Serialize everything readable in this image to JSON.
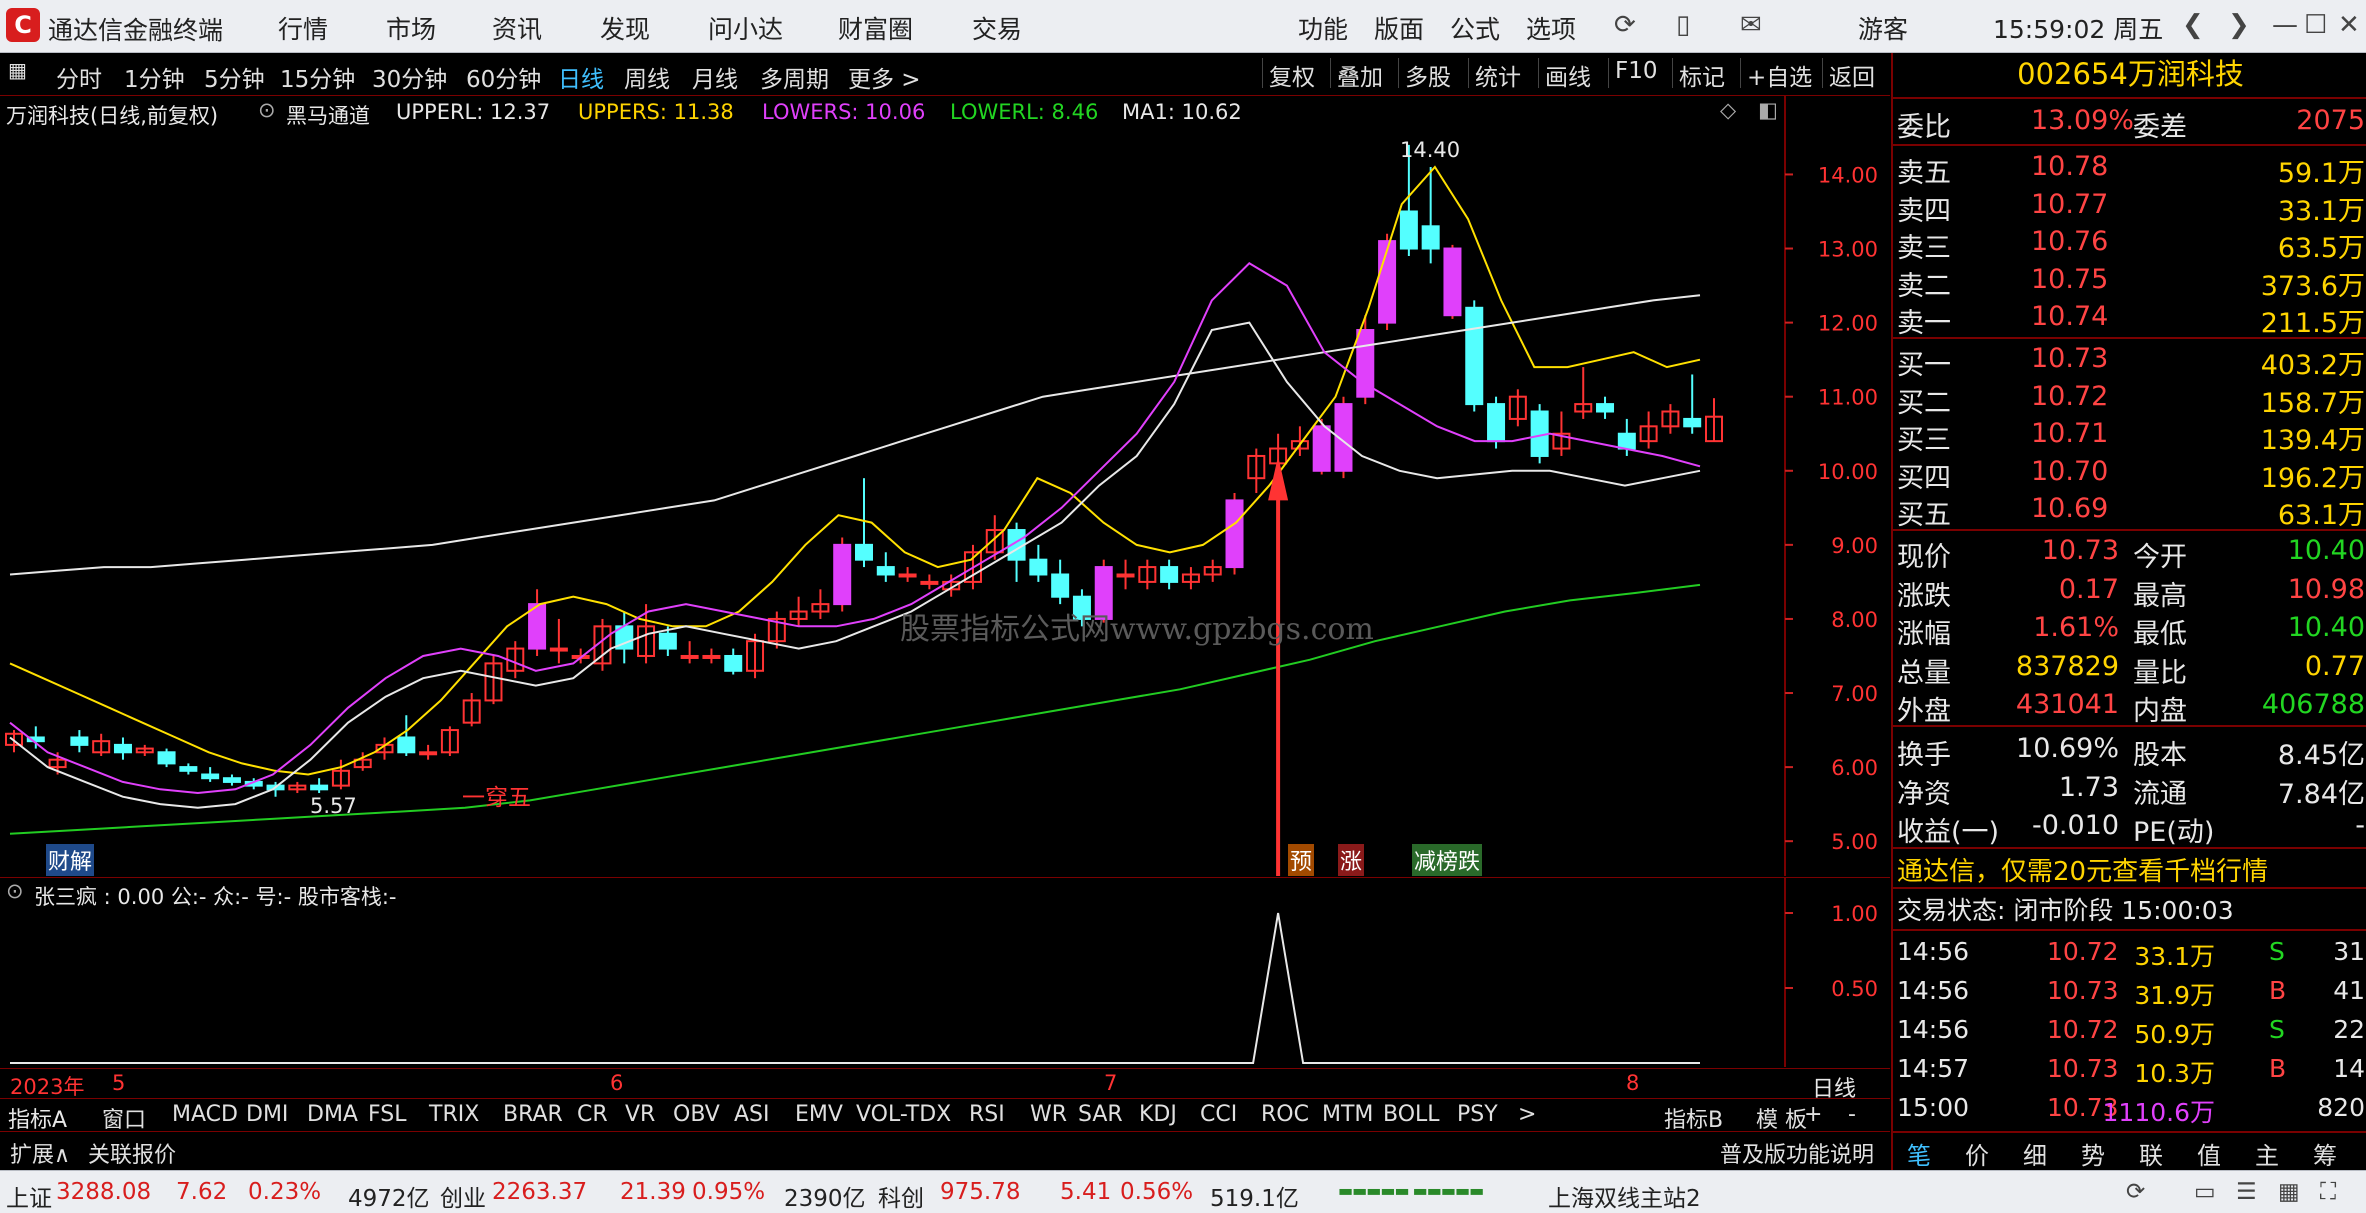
{
  "window": {
    "app_title": "通达信金融终端",
    "menu": [
      "行情",
      "市场",
      "资讯",
      "发现",
      "问小达",
      "财富圈",
      "交易"
    ],
    "right_menu": [
      "功能",
      "版面",
      "公式",
      "选项"
    ],
    "user": "游客",
    "clock": "15:59:02 周五"
  },
  "periods": [
    "分时",
    "1分钟",
    "5分钟",
    "15分钟",
    "30分钟",
    "60分钟",
    "日线",
    "周线",
    "月线",
    "多周期",
    "更多 >"
  ],
  "active_period": "日线",
  "right_buttons": [
    "复权",
    "叠加",
    "多股",
    "统计",
    "画线",
    "F10",
    "标记",
    "+自选",
    "返回"
  ],
  "chart_header": {
    "stock_label": "万润科技(日线,前复权)",
    "indicator": "黑马通道",
    "upperl": "UPPERL: 12.37",
    "uppers": "UPPERS: 11.38",
    "lowers": "LOWERS: 10.06",
    "lowerl": "LOWERL: 8.46",
    "ma1": "MA1: 10.62"
  },
  "chart_labels": {
    "high_label": "14.40",
    "low_label": "5.57",
    "pattern_label": "一穿五",
    "watermark": "股票指标公式网www.gpzbgs.com",
    "caijie_tag": "财解",
    "tag_yu": "预",
    "tag_zhang": "涨",
    "tag_jianbangdie": "减榜跌",
    "year_label": "2023年",
    "timeframe_label": "日线"
  },
  "ind_header": "张三疯 : 0.00  公:-  众:-  号:-  股市客栈:-",
  "colors": {
    "up": "#ff3333",
    "down": "#54ffff",
    "yellow": "#ffe000",
    "magenta": "#e040fb",
    "white": "#e8e8e8",
    "green": "#22cc22",
    "grid": "#7a0000"
  },
  "chart_data": {
    "type": "candlestick",
    "y_ticks": [
      "14.00",
      "13.00",
      "12.00",
      "11.00",
      "10.00",
      "9.00",
      "8.00",
      "7.00",
      "6.00",
      "5.00"
    ],
    "ylim": [
      4.8,
      14.6
    ],
    "x_labels": [
      "5",
      "6",
      "7",
      "8"
    ],
    "ind_y_ticks": [
      "1.00",
      "0.50"
    ],
    "series": [
      {
        "name": "UPPERL",
        "color": "yellow"
      },
      {
        "name": "UPPERS",
        "color": "white"
      },
      {
        "name": "LOWERS",
        "color": "magenta"
      },
      {
        "name": "MA1",
        "color": "green"
      }
    ],
    "candles": [
      [
        6.3,
        6.45,
        6.5,
        6.2
      ],
      [
        6.4,
        6.35,
        6.55,
        6.25
      ],
      [
        6.0,
        6.1,
        6.2,
        5.9
      ],
      [
        6.4,
        6.3,
        6.5,
        6.2
      ],
      [
        6.2,
        6.35,
        6.45,
        6.15
      ],
      [
        6.3,
        6.2,
        6.4,
        6.1
      ],
      [
        6.2,
        6.25,
        6.3,
        6.15
      ],
      [
        6.2,
        6.05,
        6.25,
        6.0
      ],
      [
        6.0,
        5.95,
        6.05,
        5.9
      ],
      [
        5.9,
        5.85,
        6.0,
        5.8
      ],
      [
        5.85,
        5.8,
        5.9,
        5.75
      ],
      [
        5.8,
        5.75,
        5.85,
        5.7
      ],
      [
        5.75,
        5.7,
        5.8,
        5.6
      ],
      [
        5.7,
        5.75,
        5.8,
        5.65
      ],
      [
        5.75,
        5.7,
        5.85,
        5.65
      ],
      [
        5.75,
        5.95,
        6.1,
        5.7
      ],
      [
        6.0,
        6.1,
        6.2,
        5.95
      ],
      [
        6.2,
        6.3,
        6.4,
        6.1
      ],
      [
        6.4,
        6.2,
        6.7,
        6.15
      ],
      [
        6.2,
        6.2,
        6.3,
        6.1
      ],
      [
        6.2,
        6.5,
        6.55,
        6.15
      ],
      [
        6.6,
        6.9,
        7.0,
        6.55
      ],
      [
        6.9,
        7.4,
        7.5,
        6.85
      ],
      [
        7.3,
        7.6,
        7.7,
        7.2
      ],
      [
        7.6,
        8.2,
        8.4,
        7.5
      ],
      [
        7.6,
        7.6,
        8.0,
        7.4
      ],
      [
        7.5,
        7.5,
        7.6,
        7.4
      ],
      [
        7.4,
        7.9,
        8.0,
        7.3
      ],
      [
        7.9,
        7.6,
        8.1,
        7.4
      ],
      [
        7.5,
        7.9,
        8.2,
        7.4
      ],
      [
        7.8,
        7.6,
        7.9,
        7.5
      ],
      [
        7.5,
        7.5,
        7.7,
        7.4
      ],
      [
        7.5,
        7.5,
        7.6,
        7.4
      ],
      [
        7.5,
        7.3,
        7.6,
        7.25
      ],
      [
        7.3,
        7.7,
        7.8,
        7.2
      ],
      [
        7.7,
        8.0,
        8.1,
        7.6
      ],
      [
        8.0,
        8.1,
        8.3,
        7.9
      ],
      [
        8.1,
        8.2,
        8.4,
        8.0
      ],
      [
        8.2,
        9.0,
        9.1,
        8.1
      ],
      [
        9.0,
        8.8,
        9.9,
        8.7
      ],
      [
        8.7,
        8.6,
        8.9,
        8.5
      ],
      [
        8.6,
        8.6,
        8.7,
        8.5
      ],
      [
        8.5,
        8.5,
        8.6,
        8.4
      ],
      [
        8.4,
        8.5,
        8.6,
        8.3
      ],
      [
        8.5,
        8.9,
        9.0,
        8.4
      ],
      [
        8.9,
        9.2,
        9.4,
        8.8
      ],
      [
        9.2,
        8.8,
        9.3,
        8.5
      ],
      [
        8.8,
        8.6,
        9.0,
        8.5
      ],
      [
        8.6,
        8.3,
        8.8,
        8.2
      ],
      [
        8.3,
        8.0,
        8.4,
        7.9
      ],
      [
        8.0,
        8.7,
        8.8,
        7.95
      ],
      [
        8.6,
        8.6,
        8.8,
        8.4
      ],
      [
        8.5,
        8.7,
        8.8,
        8.4
      ],
      [
        8.7,
        8.5,
        8.8,
        8.4
      ],
      [
        8.5,
        8.6,
        8.7,
        8.4
      ],
      [
        8.6,
        8.7,
        8.8,
        8.5
      ],
      [
        8.7,
        9.6,
        9.7,
        8.6
      ],
      [
        9.9,
        10.2,
        10.3,
        9.7
      ],
      [
        10.1,
        10.3,
        10.5,
        10.0
      ],
      [
        10.3,
        10.4,
        10.6,
        10.2
      ],
      [
        10.0,
        10.6,
        10.7,
        9.95
      ],
      [
        10.0,
        10.9,
        11.0,
        9.9
      ],
      [
        11.0,
        11.9,
        12.1,
        10.9
      ],
      [
        12.0,
        13.1,
        13.2,
        11.9
      ],
      [
        13.5,
        13.0,
        14.4,
        12.9
      ],
      [
        13.3,
        13.0,
        14.1,
        12.8
      ],
      [
        12.1,
        13.0,
        13.05,
        12.05
      ],
      [
        12.2,
        10.9,
        12.3,
        10.8
      ],
      [
        10.9,
        10.4,
        11.0,
        10.3
      ],
      [
        10.7,
        11.0,
        11.1,
        10.6
      ],
      [
        10.8,
        10.2,
        10.9,
        10.1
      ],
      [
        10.3,
        10.5,
        10.8,
        10.2
      ],
      [
        10.8,
        10.9,
        11.4,
        10.7
      ],
      [
        10.9,
        10.8,
        11.0,
        10.7
      ],
      [
        10.5,
        10.3,
        10.7,
        10.2
      ],
      [
        10.4,
        10.6,
        10.8,
        10.3
      ],
      [
        10.6,
        10.8,
        10.9,
        10.5
      ],
      [
        10.7,
        10.6,
        11.3,
        10.5
      ],
      [
        10.4,
        10.73,
        10.98,
        10.4
      ]
    ],
    "upperl": [
      7.4,
      7.2,
      7.0,
      6.8,
      6.6,
      6.4,
      6.2,
      6.05,
      5.95,
      5.9,
      6.0,
      6.2,
      6.5,
      6.9,
      7.4,
      7.9,
      8.2,
      8.3,
      8.2,
      8.0,
      7.9,
      7.9,
      8.1,
      8.5,
      9.0,
      9.4,
      9.3,
      8.9,
      8.7,
      8.8,
      9.2,
      9.9,
      9.7,
      9.3,
      9.0,
      8.9,
      9.0,
      9.3,
      9.8,
      10.4,
      11.0,
      12.2,
      13.6,
      14.1,
      13.4,
      12.3,
      11.4,
      11.4,
      11.5,
      11.6,
      11.4,
      11.5
    ],
    "uppers": [
      8.6,
      8.65,
      8.7,
      8.7,
      8.75,
      8.8,
      8.85,
      8.9,
      8.95,
      9.0,
      9.1,
      9.2,
      9.3,
      9.4,
      9.5,
      9.6,
      9.8,
      10.0,
      10.2,
      10.4,
      10.6,
      10.8,
      11.0,
      11.1,
      11.2,
      11.3,
      11.4,
      11.5,
      11.6,
      11.7,
      11.8,
      11.9,
      12.0,
      12.1,
      12.2,
      12.3,
      12.37
    ],
    "lowers": [
      6.6,
      6.2,
      6.0,
      5.8,
      5.7,
      5.65,
      5.7,
      5.9,
      6.3,
      6.8,
      7.2,
      7.5,
      7.6,
      7.5,
      7.3,
      7.4,
      7.8,
      8.1,
      8.2,
      8.1,
      8.0,
      7.9,
      7.9,
      8.0,
      8.2,
      8.5,
      8.8,
      9.1,
      9.5,
      10.0,
      10.5,
      11.2,
      12.3,
      12.8,
      12.5,
      11.6,
      11.2,
      10.9,
      10.6,
      10.4,
      10.4,
      10.5,
      10.4,
      10.3,
      10.2,
      10.06
    ],
    "lowerl": [
      6.4,
      6.0,
      5.8,
      5.6,
      5.5,
      5.45,
      5.5,
      5.7,
      6.1,
      6.6,
      6.95,
      7.2,
      7.3,
      7.2,
      7.1,
      7.2,
      7.6,
      7.8,
      7.9,
      7.8,
      7.7,
      7.6,
      7.7,
      7.9,
      8.1,
      8.4,
      8.7,
      9.0,
      9.3,
      9.8,
      10.2,
      10.9,
      11.9,
      12.0,
      11.2,
      10.6,
      10.2,
      10.0,
      9.9,
      9.95,
      10.0,
      10.0,
      9.9,
      9.8,
      9.9,
      10.0
    ],
    "ma1": [
      5.1,
      5.15,
      5.2,
      5.25,
      5.3,
      5.35,
      5.4,
      5.45,
      5.55,
      5.7,
      5.85,
      6.0,
      6.15,
      6.3,
      6.45,
      6.6,
      6.75,
      6.9,
      7.05,
      7.25,
      7.45,
      7.7,
      7.9,
      8.1,
      8.25,
      8.35,
      8.46
    ],
    "ind_spike": {
      "index": 58,
      "value": 1.0
    }
  },
  "right_panel": {
    "code": "002654",
    "name": "万润科技",
    "weibi_label": "委比",
    "weibi": "13.09%",
    "weicha_label": "委差",
    "weicha": "2075",
    "asks": [
      {
        "label": "卖五",
        "price": "10.78",
        "vol": "59.1万"
      },
      {
        "label": "卖四",
        "price": "10.77",
        "vol": "33.1万"
      },
      {
        "label": "卖三",
        "price": "10.76",
        "vol": "63.5万"
      },
      {
        "label": "卖二",
        "price": "10.75",
        "vol": "373.6万"
      },
      {
        "label": "卖一",
        "price": "10.74",
        "vol": "211.5万"
      }
    ],
    "bids": [
      {
        "label": "买一",
        "price": "10.73",
        "vol": "403.2万"
      },
      {
        "label": "买二",
        "price": "10.72",
        "vol": "158.7万"
      },
      {
        "label": "买三",
        "price": "10.71",
        "vol": "139.4万"
      },
      {
        "label": "买四",
        "price": "10.70",
        "vol": "196.2万"
      },
      {
        "label": "买五",
        "price": "10.69",
        "vol": "63.1万"
      }
    ],
    "stats": [
      {
        "l1": "现价",
        "v1": "10.73",
        "c1": "red",
        "l2": "今开",
        "v2": "10.40",
        "c2": "green"
      },
      {
        "l1": "涨跌",
        "v1": "0.17",
        "c1": "red",
        "l2": "最高",
        "v2": "10.98",
        "c2": "red"
      },
      {
        "l1": "涨幅",
        "v1": "1.61%",
        "c1": "red",
        "l2": "最低",
        "v2": "10.40",
        "c2": "green"
      },
      {
        "l1": "总量",
        "v1": "837829",
        "c1": "yellow",
        "l2": "量比",
        "v2": "0.77",
        "c2": "yellow"
      },
      {
        "l1": "外盘",
        "v1": "431041",
        "c1": "red",
        "l2": "内盘",
        "v2": "406788",
        "c2": "green"
      }
    ],
    "stats2": [
      {
        "l1": "换手",
        "v1": "10.69%",
        "l2": "股本",
        "v2": "8.45亿"
      },
      {
        "l1": "净资",
        "v1": "1.73",
        "l2": "流通",
        "v2": "7.84亿"
      },
      {
        "l1": "收益(一)",
        "v1": "-0.010",
        "l2": "PE(动)",
        "v2": "-"
      }
    ],
    "promo": "通达信，仅需20元查看千档行情",
    "trade_status": "交易状态: 闭市阶段 15:00:03",
    "ticks": [
      {
        "t": "14:56",
        "p": "10.72",
        "v": "33.1万",
        "bs": "S",
        "n": "31"
      },
      {
        "t": "14:56",
        "p": "10.73",
        "v": "31.9万",
        "bs": "B",
        "n": "41"
      },
      {
        "t": "14:56",
        "p": "10.72",
        "v": "50.9万",
        "bs": "S",
        "n": "22"
      },
      {
        "t": "14:57",
        "p": "10.73",
        "v": "10.3万",
        "bs": "B",
        "n": "14"
      },
      {
        "t": "15:00",
        "p": "10.73",
        "v": "1110.6万",
        "bs": "",
        "n": "820"
      }
    ],
    "tabs": [
      "笔",
      "价",
      "细",
      "势",
      "联",
      "值",
      "主",
      "筹"
    ]
  },
  "ind_tabs": [
    "指标A",
    "窗口",
    "MACD",
    "DMI",
    "DMA",
    "FSL",
    "TRIX",
    "BRAR",
    "CR",
    "VR",
    "OBV",
    "ASI",
    "EMV",
    "VOL-TDX",
    "RSI",
    "WR",
    "SAR",
    "KDJ",
    "CCI",
    "ROC",
    "MTM",
    "BOLL",
    "PSY",
    ">"
  ],
  "ind_tabs_right": [
    "指标B",
    "模 板",
    "+",
    "-"
  ],
  "ext_bar": {
    "left1": "扩展∧",
    "left2": "关联报价",
    "right": "普及版功能说明"
  },
  "status_bar": {
    "sh_label": "上证",
    "sh": "3288.08",
    "sh_chg": "7.62",
    "sh_pct": "0.23%",
    "sh_amt": "4972亿",
    "cy_label": "创业",
    "cy": "2263.37",
    "cy_chg": "21.39",
    "cy_pct": "0.95%",
    "cy_amt": "2390亿",
    "kc_label": "科创",
    "kc": "975.78",
    "kc_chg": "5.41",
    "kc_pct": "0.56%",
    "kc_amt": "519.1亿",
    "server": "上海双线主站2"
  }
}
